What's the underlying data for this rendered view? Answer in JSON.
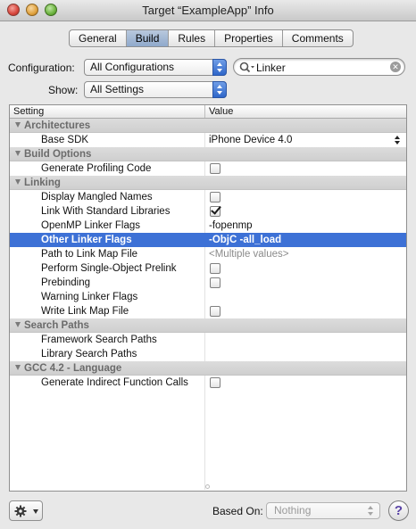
{
  "window": {
    "title": "Target “ExampleApp” Info"
  },
  "tabs": [
    {
      "label": "General",
      "active": false
    },
    {
      "label": "Build",
      "active": true
    },
    {
      "label": "Rules",
      "active": false
    },
    {
      "label": "Properties",
      "active": false
    },
    {
      "label": "Comments",
      "active": false
    }
  ],
  "configuration": {
    "label": "Configuration:",
    "value": "All Configurations"
  },
  "show": {
    "label": "Show:",
    "value": "All Settings"
  },
  "search": {
    "value": "Linker",
    "icon": "magnifier-icon"
  },
  "table": {
    "headers": {
      "setting": "Setting",
      "value": "Value"
    },
    "rows": [
      {
        "type": "group",
        "label": "Architectures"
      },
      {
        "type": "item",
        "label": "Base SDK",
        "value": "iPhone Device 4.0",
        "control": "popup"
      },
      {
        "type": "group",
        "label": "Build Options"
      },
      {
        "type": "item",
        "label": "Generate Profiling Code",
        "control": "checkbox",
        "checked": false
      },
      {
        "type": "group",
        "label": "Linking"
      },
      {
        "type": "item",
        "label": "Display Mangled Names",
        "control": "checkbox",
        "checked": false
      },
      {
        "type": "item",
        "label": "Link With Standard Libraries",
        "control": "checkbox",
        "checked": true
      },
      {
        "type": "item",
        "label": "OpenMP Linker Flags",
        "value": "-fopenmp",
        "control": "text"
      },
      {
        "type": "item",
        "label": "Other Linker Flags",
        "value": "-ObjC -all_load",
        "control": "text",
        "selected": true
      },
      {
        "type": "item",
        "label": "Path to Link Map File",
        "value": "<Multiple values>",
        "control": "placeholder"
      },
      {
        "type": "item",
        "label": "Perform Single-Object Prelink",
        "control": "checkbox",
        "checked": false
      },
      {
        "type": "item",
        "label": "Prebinding",
        "control": "checkbox",
        "checked": false
      },
      {
        "type": "item",
        "label": "Warning Linker Flags",
        "value": "",
        "control": "text"
      },
      {
        "type": "item",
        "label": "Write Link Map File",
        "control": "checkbox",
        "checked": false
      },
      {
        "type": "group",
        "label": "Search Paths"
      },
      {
        "type": "item",
        "label": "Framework Search Paths",
        "value": "",
        "control": "text"
      },
      {
        "type": "item",
        "label": "Library Search Paths",
        "value": "",
        "control": "text"
      },
      {
        "type": "group",
        "label": "GCC 4.2 - Language"
      },
      {
        "type": "item",
        "label": "Generate Indirect Function Calls",
        "control": "checkbox",
        "checked": false
      }
    ]
  },
  "footer": {
    "based_on_label": "Based On:",
    "based_on_value": "Nothing",
    "help_label": "?",
    "gear_icon": "gear-icon"
  },
  "colors": {
    "selection": "#3d71d6",
    "accent_popup": "#2f66c9"
  }
}
